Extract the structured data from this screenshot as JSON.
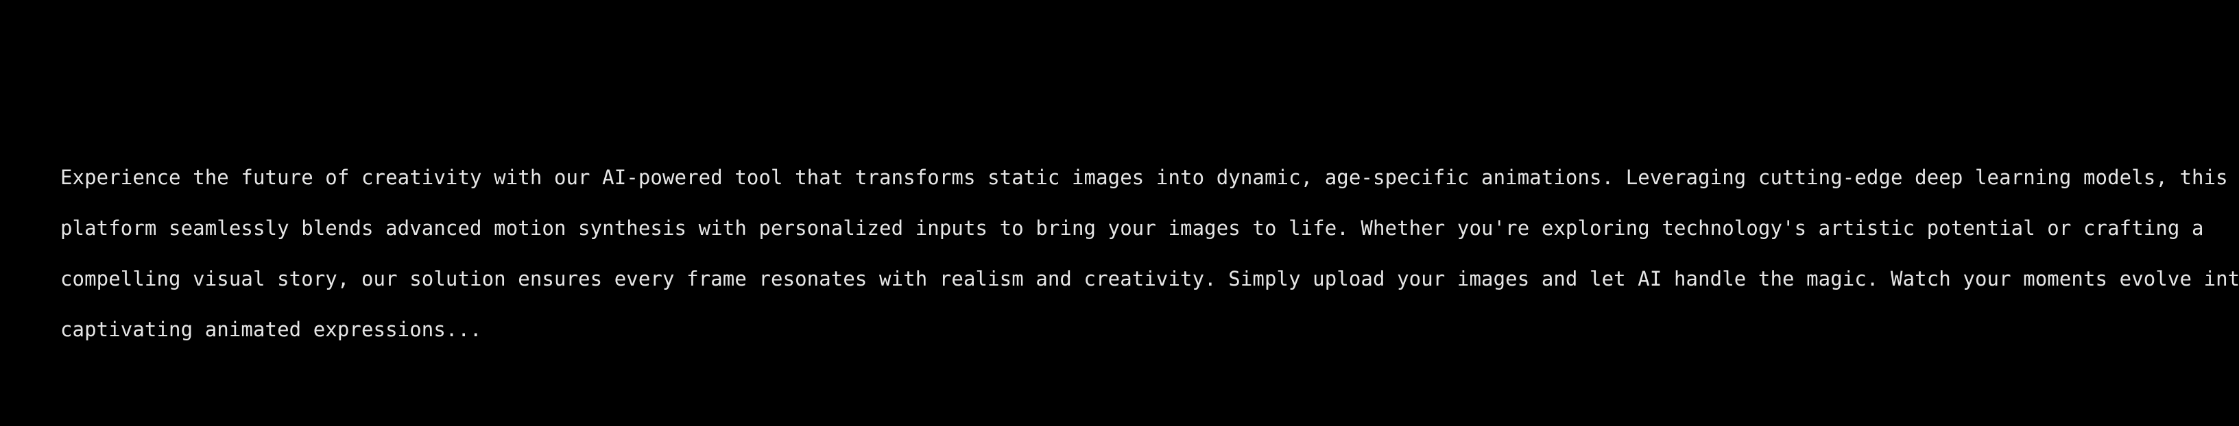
{
  "description": {
    "lines": [
      "Experience the future of creativity with our AI-powered tool that transforms static images into dynamic, age-specific animations. Leveraging cutting-edge deep learning models, this",
      "platform seamlessly blends advanced motion synthesis with personalized inputs to bring your images to life. Whether you're exploring technology's artistic potential or crafting a",
      "compelling visual story, our solution ensures every frame resonates with realism and creativity. Simply upload your images and let AI handle the magic. Watch your moments evolve into",
      "captivating animated expressions..."
    ]
  },
  "colors": {
    "background": "#000000",
    "text": "#e6e6e6"
  }
}
